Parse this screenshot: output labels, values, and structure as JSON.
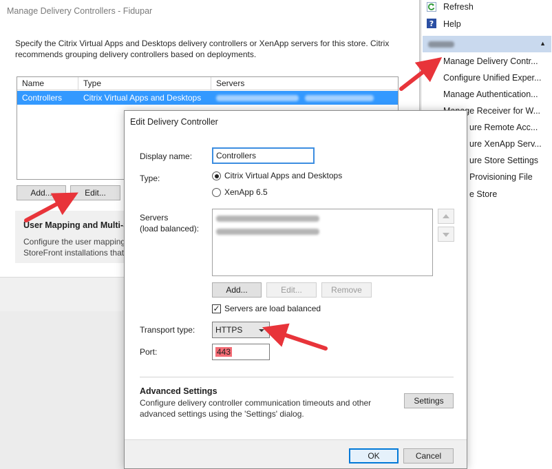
{
  "bg_window": {
    "title": "Manage Delivery Controllers - Fidupar",
    "description": "Specify the Citrix Virtual Apps and Desktops delivery controllers or XenApp servers for this store. Citrix recommends grouping delivery controllers based on deployments.",
    "table": {
      "columns": [
        "Name",
        "Type",
        "Servers"
      ],
      "row": {
        "name": "Controllers",
        "type": "Citrix Virtual Apps and Desktops"
      }
    },
    "add_label": "Add...",
    "edit_label": "Edit...",
    "section_title": "User Mapping and Multi-Si",
    "section_desc": "Configure the user mapping StoreFront installations that"
  },
  "actions": {
    "refresh": "Refresh",
    "help": "Help",
    "items": [
      "Manage Delivery Contr...",
      "Configure Unified Exper...",
      "Manage Authentication...",
      "Manage Receiver for W...",
      "ure Remote Acc...",
      "ure XenApp Serv...",
      "ure Store Settings",
      "Provisioning File",
      "e Store"
    ]
  },
  "dialog": {
    "title": "Edit Delivery Controller",
    "display_name_label": "Display name:",
    "display_name_value": "Controllers",
    "type_label": "Type:",
    "type_options": [
      "Citrix Virtual Apps and Desktops",
      "XenApp 6.5"
    ],
    "type_selected": "Citrix Virtual Apps and Desktops",
    "servers_label": "Servers",
    "servers_sublabel": "(load balanced):",
    "add_label": "Add...",
    "edit_label": "Edit...",
    "remove_label": "Remove",
    "load_balanced_label": "Servers are load balanced",
    "load_balanced_checked": true,
    "transport_label": "Transport type:",
    "transport_value": "HTTPS",
    "port_label": "Port:",
    "port_value": "443",
    "advanced_title": "Advanced Settings",
    "advanced_desc": "Configure delivery controller communication timeouts and other advanced settings using the 'Settings' dialog.",
    "settings_label": "Settings",
    "ok_label": "OK",
    "cancel_label": "Cancel"
  },
  "colors": {
    "selection": "#3399ff",
    "annotation_red": "#e8343a",
    "port_highlight": "#f36c75",
    "primary_border": "#0078d7"
  }
}
